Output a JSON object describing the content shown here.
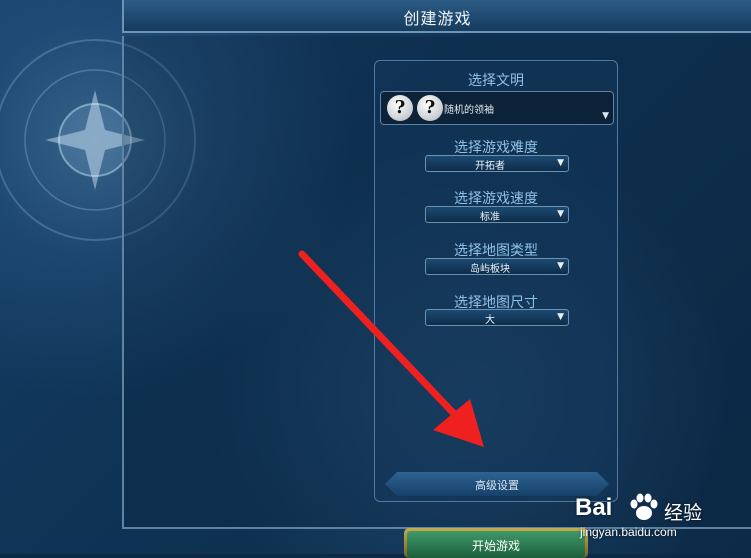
{
  "header": {
    "title": "创建游戏"
  },
  "civilization": {
    "label": "选择文明",
    "leader_value": "随机的领袖",
    "icon_glyph": "?"
  },
  "difficulty": {
    "label": "选择游戏难度",
    "value": "开拓者"
  },
  "speed": {
    "label": "选择游戏速度",
    "value": "标准"
  },
  "map_type": {
    "label": "选择地图类型",
    "value": "岛屿板块"
  },
  "map_size": {
    "label": "选择地图尺寸",
    "value": "大"
  },
  "advanced_button": {
    "label": "高级设置"
  },
  "start_button": {
    "label": "开始游戏"
  },
  "dropdown_arrow": "▼",
  "watermark": {
    "brand": "Bai",
    "brand_cn": "经验",
    "url": "jingyan.baidu.com"
  },
  "colors": {
    "annotation_arrow": "#ef2020",
    "accent_label": "#8fc1e6",
    "start_green": "#2e7d52"
  }
}
